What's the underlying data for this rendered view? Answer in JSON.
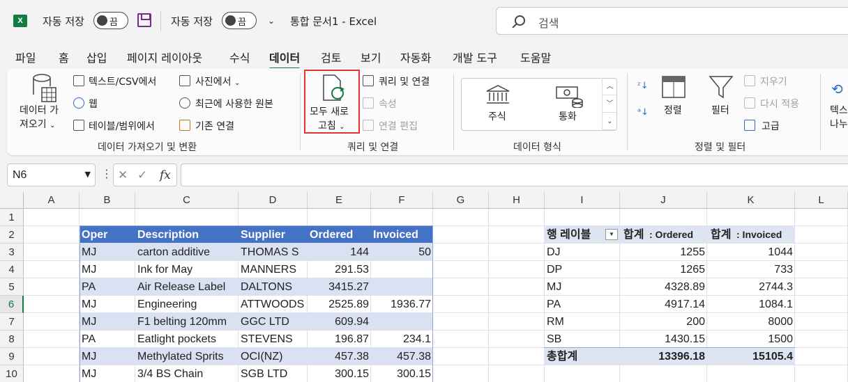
{
  "titlebar": {
    "autosave1": "자동 저장",
    "toggle1": "끔",
    "autosave2": "자동 저장",
    "toggle2": "끔",
    "doc_title": "통합 문서1  -  Excel",
    "search_placeholder": "검색"
  },
  "tabs": [
    "파일",
    "홈",
    "삽입",
    "페이지 레이아웃",
    "수식",
    "데이터",
    "검토",
    "보기",
    "자동화",
    "개발 도구",
    "도움말"
  ],
  "ribbon": {
    "get_data_l1": "데이터 가",
    "get_data_l2": "져오기",
    "from_text_csv": "텍스트/CSV에서",
    "from_web": "웹",
    "from_table_range": "테이블/범위에서",
    "from_picture": "사진에서",
    "recent_sources": "최근에 사용한 원본",
    "existing_connections": "기존 연결",
    "group_get_transform": "데이터 가져오기 및 변환",
    "refresh_all_l1": "모두 새로",
    "refresh_all_l2": "고침",
    "queries_connections": "쿼리 및 연결",
    "properties": "속성",
    "edit_links": "연결 편집",
    "group_queries": "쿼리 및 연결",
    "stocks": "주식",
    "currencies": "통화",
    "group_data_types": "데이터 형식",
    "sort": "정렬",
    "filter": "필터",
    "clear": "지우기",
    "reapply": "다시 적용",
    "advanced": "고급",
    "group_sort_filter": "정렬 및 필터",
    "text_to_cols_l1": "텍스",
    "text_to_cols_l2": "나누"
  },
  "formula_bar": {
    "name_box": "N6",
    "fx": "fx",
    "formula": ""
  },
  "grid": {
    "columns": [
      "A",
      "B",
      "C",
      "D",
      "E",
      "F",
      "G",
      "H",
      "I",
      "J",
      "K",
      "L"
    ],
    "rows": [
      "1",
      "2",
      "3",
      "4",
      "5",
      "6",
      "7",
      "8",
      "9",
      "10"
    ],
    "selected_row": "6",
    "table_headers": [
      "Oper",
      "Description",
      "Supplier",
      "Ordered",
      "Invoiced"
    ],
    "table_rows": [
      [
        "MJ",
        "carton additive",
        "THOMAS S",
        "144",
        "50"
      ],
      [
        "MJ",
        "Ink for May",
        "MANNERS",
        "291.53",
        ""
      ],
      [
        "PA",
        "Air Release Label",
        "DALTONS",
        "3415.27",
        ""
      ],
      [
        "MJ",
        "Engineering",
        "ATTWOODS",
        "2525.89",
        "1936.77"
      ],
      [
        "MJ",
        "F1 belting 120mm",
        "GGC LTD",
        "609.94",
        ""
      ],
      [
        "PA",
        "Eatlight pockets",
        "STEVENS",
        "196.87",
        "234.1"
      ],
      [
        "MJ",
        "Methylated Sprits",
        "OCI(NZ)",
        "457.38",
        "457.38"
      ],
      [
        "MJ",
        "3/4 BS Chain",
        "SGB LTD",
        "300.15",
        "300.15"
      ]
    ],
    "pivot_headers": [
      "행 레이블",
      "합계",
      ": Ordered",
      "합계",
      ": Invoiced"
    ],
    "pivot_rows": [
      [
        "DJ",
        "1255",
        "1044"
      ],
      [
        "DP",
        "1265",
        "733"
      ],
      [
        "MJ",
        "4328.89",
        "2744.3"
      ],
      [
        "PA",
        "4917.14",
        "1084.1"
      ],
      [
        "RM",
        "200",
        "8000"
      ],
      [
        "SB",
        "1430.15",
        "1500"
      ]
    ],
    "pivot_total": [
      "총합계",
      "13396.18",
      "15105.4"
    ]
  }
}
